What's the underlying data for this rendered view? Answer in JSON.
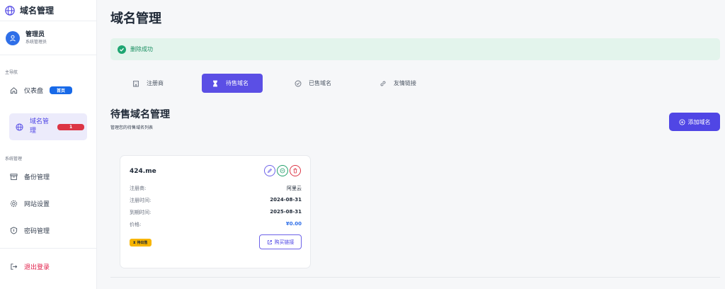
{
  "sidebar": {
    "brand": {
      "title": "域名管理",
      "icon": "globe-icon"
    },
    "user": {
      "name": "管理员",
      "role": "系统管理员"
    },
    "sections": {
      "main_nav": "主导航",
      "system": "系统管理"
    },
    "items": {
      "dashboard": {
        "label": "仪表盘",
        "badge": "首页"
      },
      "domains": {
        "label": "域名管理",
        "badge": "1"
      },
      "backup": {
        "label": "备份管理"
      },
      "settings": {
        "label": "网站设置"
      },
      "password": {
        "label": "密码管理"
      },
      "logout": {
        "label": "退出登录"
      }
    }
  },
  "main": {
    "title": "域名管理",
    "alert": {
      "text": "删除成功",
      "color": "#1ea672"
    },
    "tabs": [
      {
        "label": "注册商",
        "icon": "building-icon"
      },
      {
        "label": "待售域名",
        "icon": "hourglass-icon",
        "active": true
      },
      {
        "label": "已售域名",
        "icon": "check-circle-icon"
      },
      {
        "label": "友情链接",
        "icon": "link-icon"
      }
    ],
    "section": {
      "title": "待售域名管理",
      "subtitle": "管理您的待售域名列表",
      "add_button": "添加域名"
    },
    "card": {
      "domain": "424.me",
      "rows": {
        "registrar": {
          "label": "注册商:",
          "value": "阿里云"
        },
        "reg_date": {
          "label": "注册时间:",
          "value": "2024-08-31"
        },
        "exp_date": {
          "label": "到期时间:",
          "value": "2025-08-31"
        },
        "price": {
          "label": "价格:",
          "value": "¥0.00"
        }
      },
      "status": "待出售",
      "buy_link": "购买链接"
    }
  },
  "colors": {
    "accent": "#5046e5",
    "success": "#1ea672",
    "danger": "#dc3545",
    "warning": "#f7b500",
    "blue": "#1769e8"
  }
}
